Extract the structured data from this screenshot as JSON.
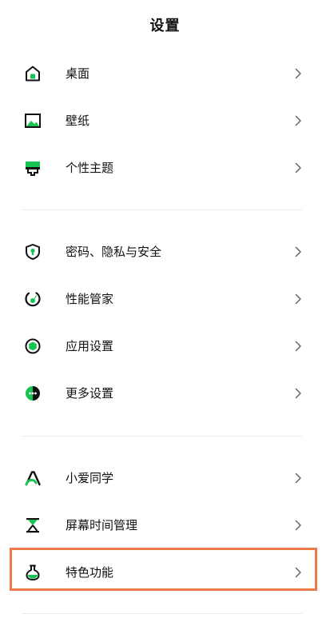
{
  "header": {
    "title": "设置"
  },
  "accent_color": "#17c451",
  "highlight_color": "#ee7a4a",
  "groups": [
    {
      "items": [
        {
          "label": "桌面",
          "icon": "home-icon"
        },
        {
          "label": "壁纸",
          "icon": "wallpaper-icon"
        },
        {
          "label": "个性主题",
          "icon": "theme-icon"
        }
      ]
    },
    {
      "items": [
        {
          "label": "密码、隐私与安全",
          "icon": "shield-icon"
        },
        {
          "label": "性能管家",
          "icon": "performance-icon"
        },
        {
          "label": "应用设置",
          "icon": "app-settings-icon"
        },
        {
          "label": "更多设置",
          "icon": "more-settings-icon"
        }
      ]
    },
    {
      "items": [
        {
          "label": "小爱同学",
          "icon": "xiaoai-icon"
        },
        {
          "label": "屏幕时间管理",
          "icon": "hourglass-icon"
        },
        {
          "label": "特色功能",
          "icon": "flask-icon",
          "highlighted": true
        }
      ]
    }
  ]
}
